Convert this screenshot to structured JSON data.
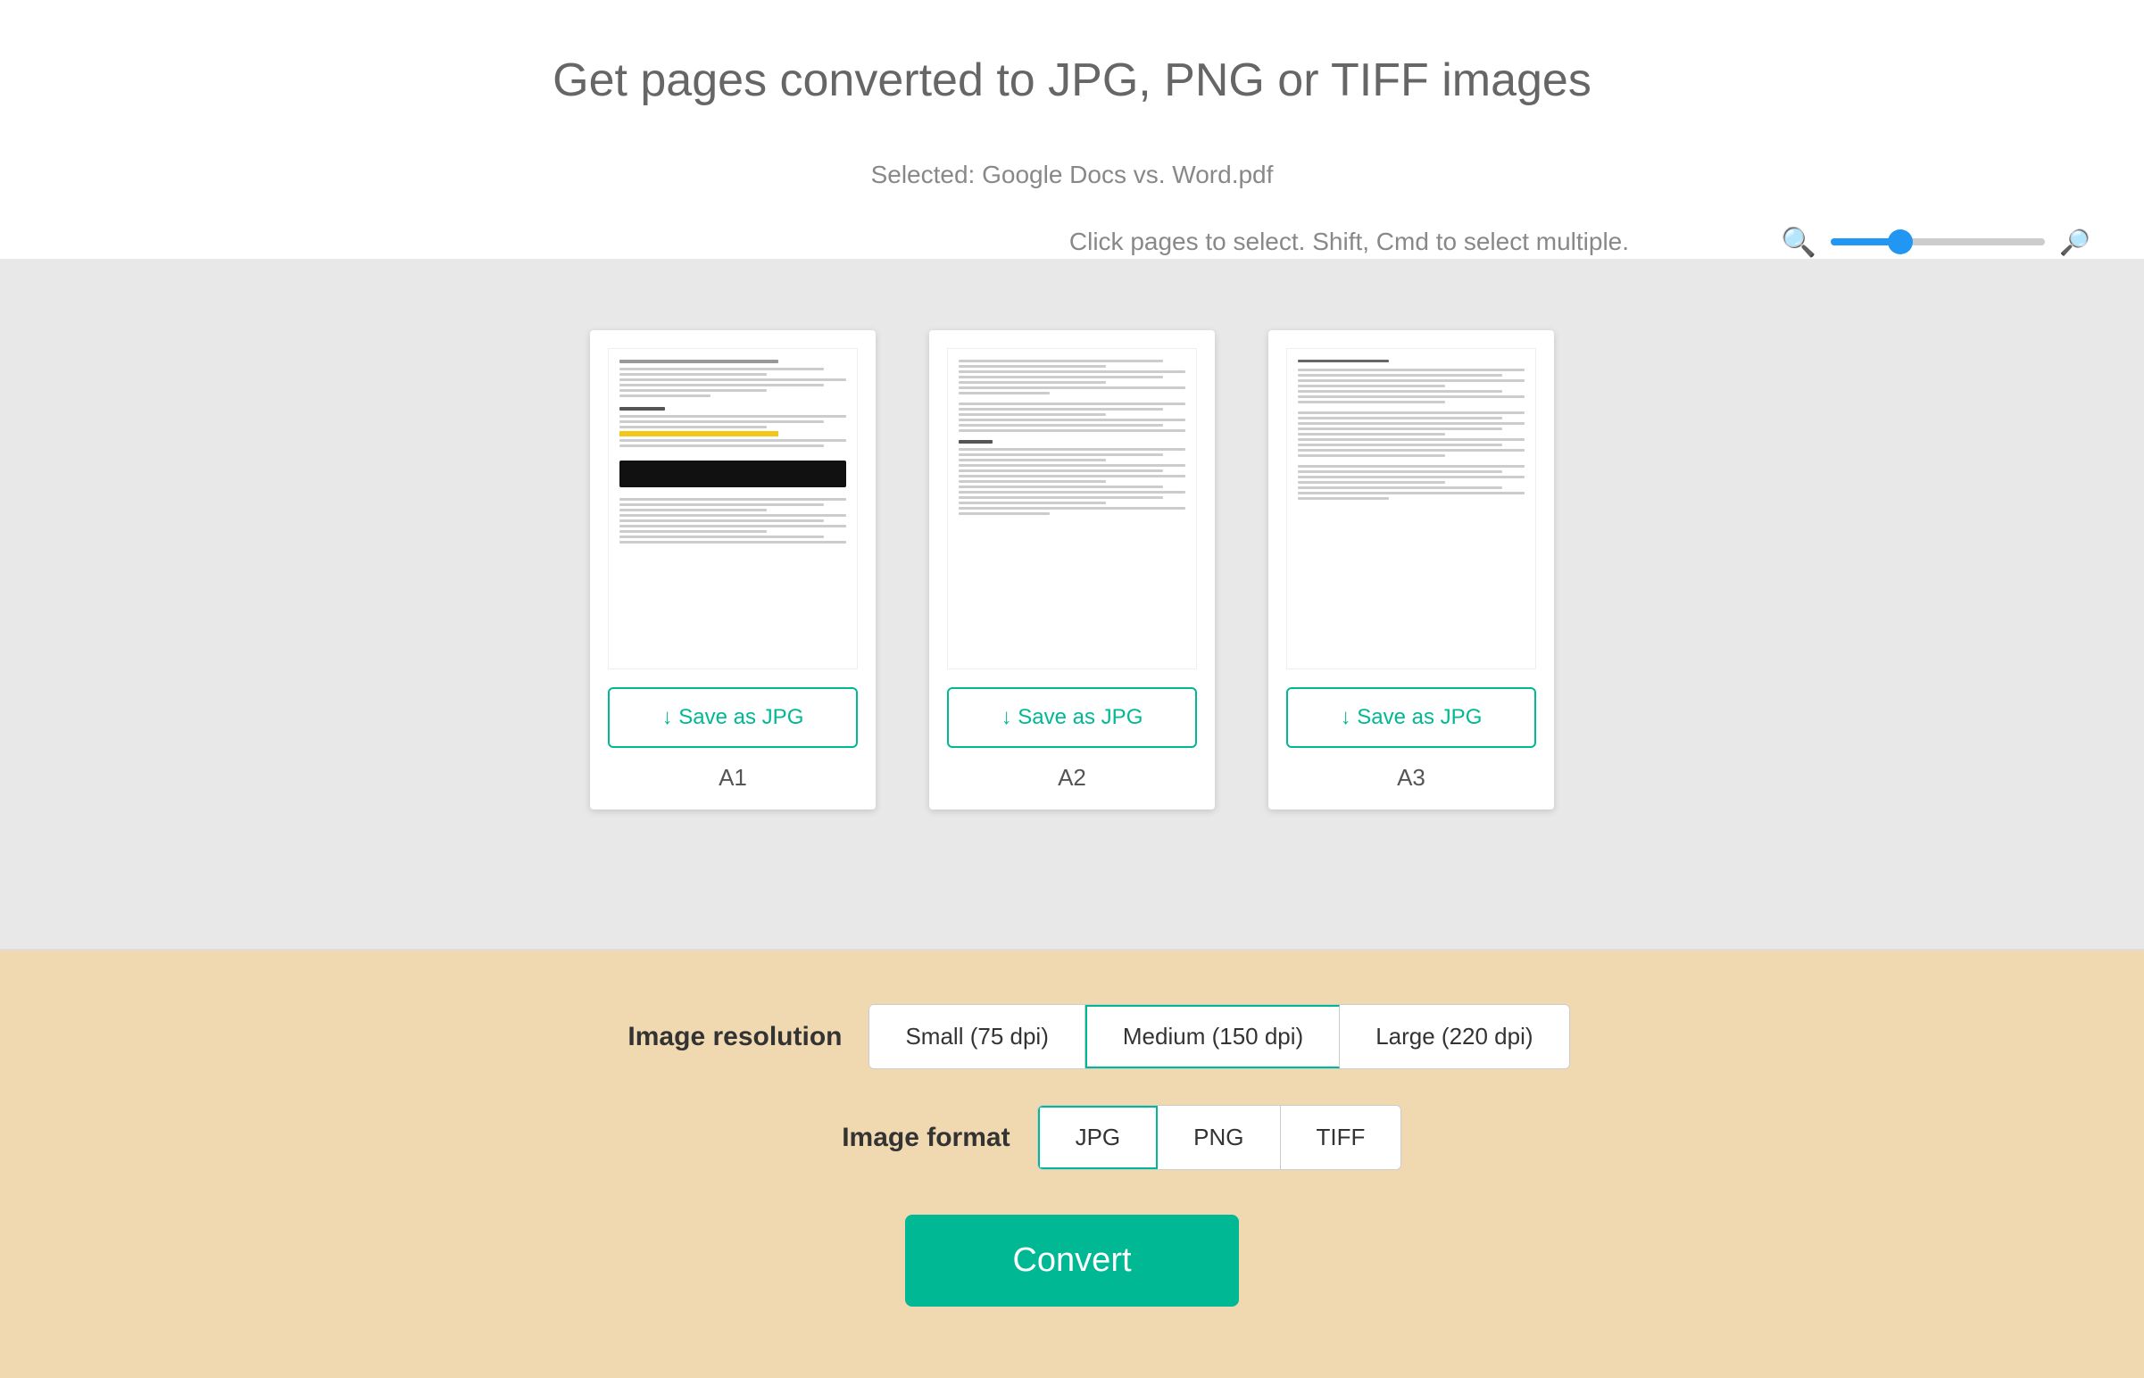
{
  "header": {
    "title": "Get pages converted to JPG, PNG or TIFF images",
    "selected_file": "Selected: Google Docs vs. Word.pdf",
    "instruction": "Click pages to select. Shift, Cmd to select multiple."
  },
  "zoom": {
    "min_icon": "🔍",
    "max_icon": "🔍",
    "value": 30
  },
  "pages": [
    {
      "id": "A1",
      "label": "A1",
      "save_button": "↓ Save as JPG"
    },
    {
      "id": "A2",
      "label": "A2",
      "save_button": "↓ Save as JPG"
    },
    {
      "id": "A3",
      "label": "A3",
      "save_button": "↓ Save as JPG"
    }
  ],
  "settings": {
    "resolution_label": "Image resolution",
    "resolution_options": [
      {
        "label": "Small (75 dpi)",
        "active": false
      },
      {
        "label": "Medium (150 dpi)",
        "active": true
      },
      {
        "label": "Large (220 dpi)",
        "active": false
      }
    ],
    "format_label": "Image format",
    "format_options": [
      {
        "label": "JPG",
        "active": true
      },
      {
        "label": "PNG",
        "active": false
      },
      {
        "label": "TIFF",
        "active": false
      }
    ],
    "convert_button": "Convert"
  }
}
